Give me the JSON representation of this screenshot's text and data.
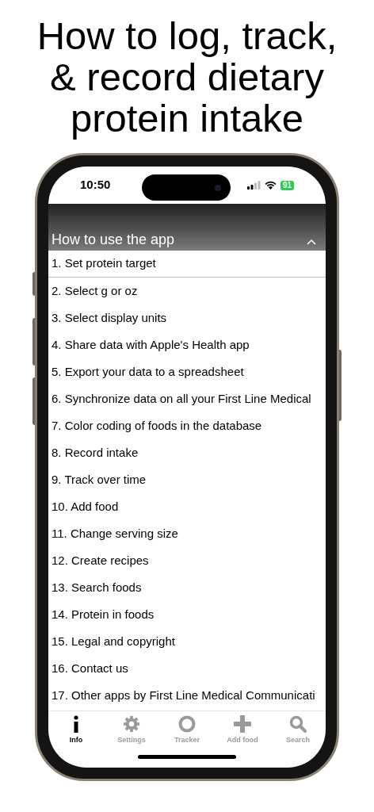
{
  "headline": [
    "How to log, track,",
    "& record dietary",
    "protein intake"
  ],
  "status_bar": {
    "time": "10:50",
    "battery": "91"
  },
  "section": {
    "title": "How to use the app",
    "expanded": true
  },
  "items": [
    "1. Set protein target",
    "2. Select g or oz",
    "3. Select display units",
    "4. Share data with Apple's Health app",
    "5. Export your data to a spreadsheet",
    "6. Synchronize data on all your First Line Medical",
    "7. Color coding of foods in the database",
    "8. Record intake",
    "9. Track over time",
    "10. Add food",
    "11. Change serving size",
    "12. Create recipes",
    "13. Search foods",
    "14. Protein in foods",
    "15. Legal and copyright",
    "16. Contact us",
    "17. Other apps by First Line Medical Communicati"
  ],
  "tabs": [
    {
      "kind": "info",
      "label": "Info",
      "selected": true
    },
    {
      "kind": "settings",
      "label": "Settings",
      "selected": false
    },
    {
      "kind": "tracker",
      "label": "Tracker",
      "selected": false
    },
    {
      "kind": "add",
      "label": "Add food",
      "selected": false
    },
    {
      "kind": "search",
      "label": "Search",
      "selected": false
    }
  ]
}
